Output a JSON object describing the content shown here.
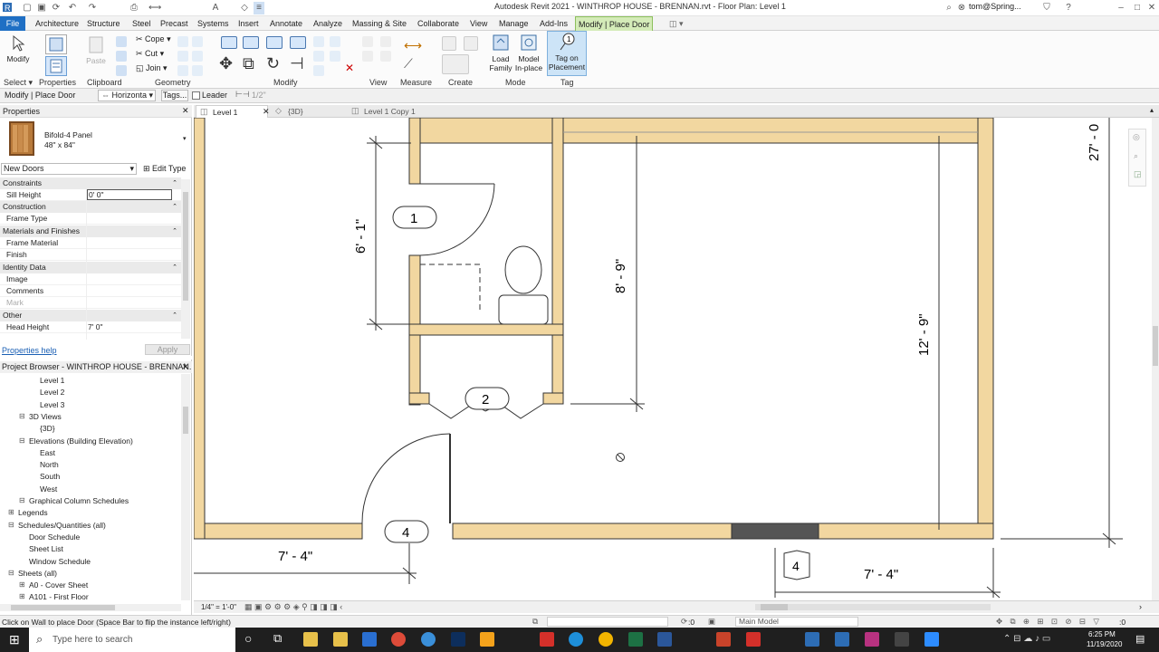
{
  "window": {
    "title": "Autodesk Revit 2021 - WINTHROP HOUSE - BRENNAN.rvt - Floor Plan: Level 1",
    "user": "tom@Spring...",
    "min": "–",
    "max": "□",
    "close": "✕"
  },
  "ribbon_tabs": [
    "File",
    "Architecture",
    "Structure",
    "Steel",
    "Precast",
    "Systems",
    "Insert",
    "Annotate",
    "Analyze",
    "Massing & Site",
    "Collaborate",
    "View",
    "Manage",
    "Add-Ins",
    "Modify | Place Door"
  ],
  "ribbon": {
    "modify_label": "Modify",
    "clipboard": {
      "paste": "Paste",
      "cope": "Cope",
      "cut": "Cut",
      "join": "Join"
    },
    "load_family": "Load\nFamily",
    "model_inplace": "Model\nIn-place",
    "tag_on_placement": "Tag on\nPlacement",
    "panels": [
      "Select",
      "Properties",
      "Clipboard",
      "Geometry",
      "Modify",
      "View",
      "Measure",
      "Create",
      "Mode",
      "Tag"
    ],
    "select_label": "Select"
  },
  "options_bar": {
    "context": "Modify | Place Door",
    "orientation": "Horizonta",
    "tags": "Tags...",
    "leader": "Leader",
    "leader_length": "1/2\""
  },
  "properties": {
    "header": "Properties",
    "type_name": "Bifold-4 Panel",
    "type_size": "48\" x 84\"",
    "selector": "New Doors",
    "edit_type": "Edit Type",
    "sections": [
      {
        "title": "Constraints",
        "rows": [
          {
            "k": "Sill Height",
            "v": "0'  0\""
          }
        ]
      },
      {
        "title": "Construction",
        "rows": [
          {
            "k": "Frame Type",
            "v": ""
          }
        ]
      },
      {
        "title": "Materials and Finishes",
        "rows": [
          {
            "k": "Frame Material",
            "v": ""
          },
          {
            "k": "Finish",
            "v": ""
          }
        ]
      },
      {
        "title": "Identity Data",
        "rows": [
          {
            "k": "Image",
            "v": ""
          },
          {
            "k": "Comments",
            "v": ""
          },
          {
            "k": "Mark",
            "v": ""
          }
        ]
      },
      {
        "title": "Other",
        "rows": [
          {
            "k": "Head Height",
            "v": "7'  0\""
          }
        ]
      }
    ],
    "help": "Properties help",
    "apply": "Apply"
  },
  "project_browser": {
    "header": "Project Browser - WINTHROP HOUSE - BRENNAN...",
    "items": [
      {
        "label": "Level 1",
        "indent": 3
      },
      {
        "label": "Level 2",
        "indent": 3
      },
      {
        "label": "Level 3",
        "indent": 3
      },
      {
        "label": "3D Views",
        "indent": 2
      },
      {
        "label": "{3D}",
        "indent": 3
      },
      {
        "label": "Elevations (Building Elevation)",
        "indent": 2
      },
      {
        "label": "East",
        "indent": 3
      },
      {
        "label": "North",
        "indent": 3
      },
      {
        "label": "South",
        "indent": 3
      },
      {
        "label": "West",
        "indent": 3
      },
      {
        "label": "Graphical Column Schedules",
        "indent": 2
      },
      {
        "label": "Legends",
        "indent": 1
      },
      {
        "label": "Schedules/Quantities (all)",
        "indent": 1
      },
      {
        "label": "Door Schedule",
        "indent": 2
      },
      {
        "label": "Sheet List",
        "indent": 2
      },
      {
        "label": "Window Schedule",
        "indent": 2
      },
      {
        "label": "Sheets (all)",
        "indent": 1
      },
      {
        "label": "A0 - Cover Sheet",
        "indent": 2
      },
      {
        "label": "A101 - First Floor",
        "indent": 2
      }
    ]
  },
  "view_tabs": [
    "Level 1",
    "{3D}",
    "Level 1 Copy 1"
  ],
  "plan": {
    "dims": {
      "d1": "6' - 1\"",
      "d2": "8' - 9\"",
      "d3": "12' - 9\"",
      "d4": "27' - 0",
      "d5": "7' - 4\"",
      "d6": "7' - 4\""
    },
    "tags": {
      "t1": "1",
      "t2": "2",
      "t4a": "4",
      "t4b": "4"
    }
  },
  "view_status": {
    "scale": "1/4\" = 1'-0\""
  },
  "status": {
    "message": "Click on Wall to place Door (Space Bar to flip the instance left/right)",
    "model": "Main Model",
    "zero": ":0"
  },
  "taskbar": {
    "search": "Type here to search",
    "time": "6:25 PM",
    "date": "11/19/2020"
  }
}
